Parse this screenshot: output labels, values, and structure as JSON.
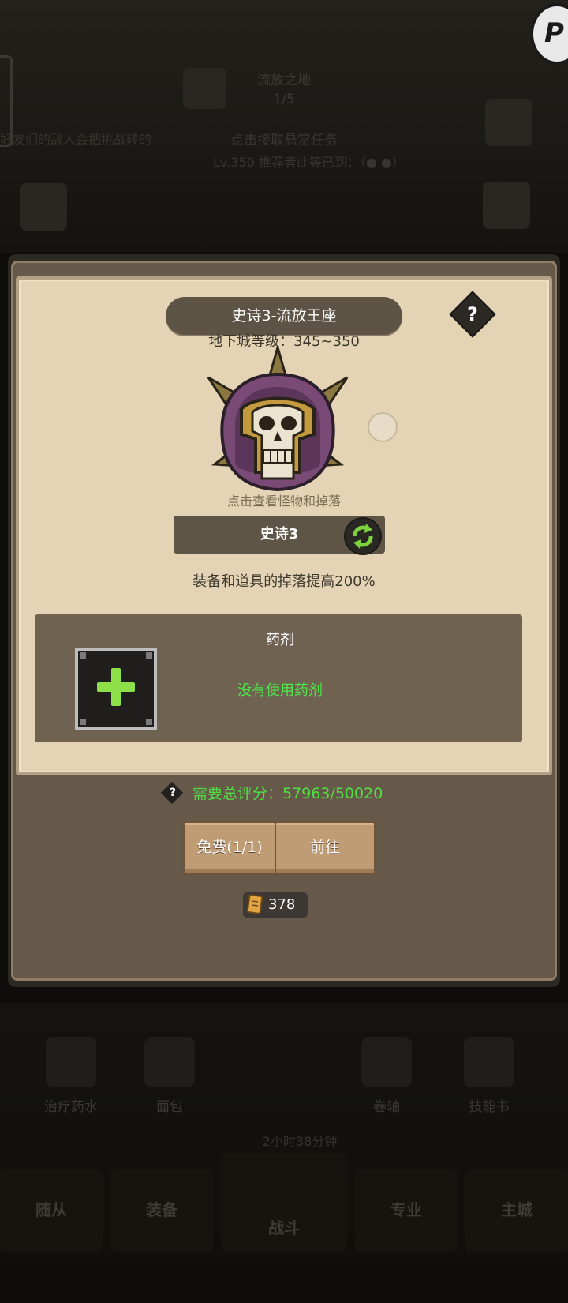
{
  "background": {
    "stage_title": "流放之地",
    "stage_progress": "1/5",
    "left_notice": "好友们的敌人会把挑战转的",
    "bounty_hint": "点击接取悬赏任务",
    "requirement_hint": "Lv.350 推荐者此等已到：（● ●）",
    "items": [
      "治疗药水",
      "面包",
      "卷轴",
      "技能书"
    ],
    "timer": "2小时38分钟",
    "nav": [
      "随从",
      "装备",
      "战斗",
      "专业",
      "主城"
    ]
  },
  "dialog": {
    "title": "史诗3-流放王座",
    "help_symbol": "?",
    "dungeon_level": "地下城等级：345~350",
    "boss_hint": "点击查看怪物和掉落",
    "difficulty": "史诗3",
    "drop_bonus": "装备和道具的掉落提高200%",
    "potion": {
      "title": "药剂",
      "status": "没有使用药剂"
    },
    "score_requirement": "需要总评分：57963/50020",
    "buttons": {
      "free": "免费(1/1)",
      "go": "前往"
    },
    "ticket_count": "378"
  },
  "colors": {
    "parchment": "#e4d4b5",
    "panel": "#665949",
    "status_green": "#4ee84b",
    "button_wood": "#bf9c74"
  },
  "icons": [
    "skull-helmet-icon",
    "swap-icon",
    "plus-icon",
    "help-icon",
    "scroll-ticket-icon"
  ]
}
